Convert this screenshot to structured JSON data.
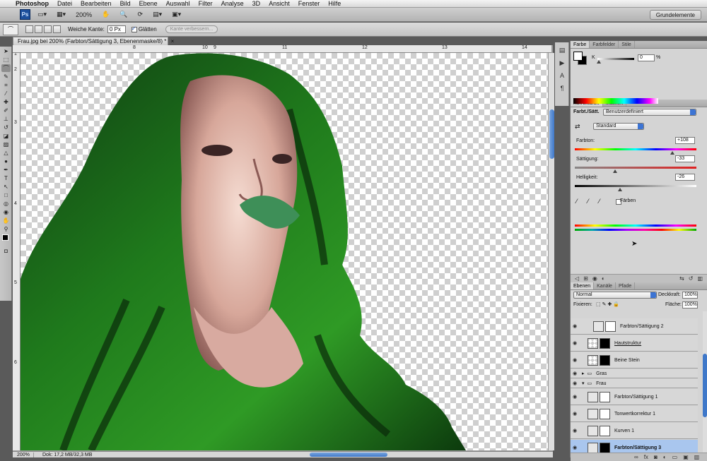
{
  "menubar": {
    "apple": "",
    "items": [
      "Photoshop",
      "Datei",
      "Bearbeiten",
      "Bild",
      "Ebene",
      "Auswahl",
      "Filter",
      "Analyse",
      "3D",
      "Ansicht",
      "Fenster",
      "Hilfe"
    ]
  },
  "appbar": {
    "ps_logo": "Ps",
    "zoom": "200%",
    "workspace": "Grundelemente"
  },
  "options": {
    "feather_label": "Weiche Kante:",
    "feather_value": "0 Px",
    "antialias_label": "Glätten",
    "refine_edge": "Kante verbessern..."
  },
  "document": {
    "tab_title": "Frau.jpg bei 200% (Farbton/Sättigung 3, Ebenenmaske/8) *",
    "ruler_h": [
      "8",
      "9",
      "10",
      "11",
      "12",
      "13",
      "14"
    ],
    "ruler_v": [
      "1",
      "2",
      "3",
      "4",
      "5",
      "6"
    ],
    "status_zoom": "200%",
    "status_info": "Dok: 17,2 MB/32,3 MB"
  },
  "color_panel": {
    "tabs": [
      "Farbe",
      "Farbfelder",
      "Stile"
    ],
    "channel": "K",
    "value": "0",
    "unit": "%"
  },
  "adjustments_panel": {
    "tabs": [
      "Korrekturen",
      "Masken"
    ],
    "type": "Farbt./Sätt.",
    "preset": "Benutzerdefiniert",
    "range": "Standard",
    "hue_label": "Farbton:",
    "hue_value": "+108",
    "hue_level": 0.8,
    "sat_label": "Sättigung:",
    "sat_value": "-33",
    "sat_level": 0.33,
    "light_label": "Helligkeit:",
    "light_value": "-26",
    "light_level": 0.37,
    "colorize_label": "Färben"
  },
  "layers_panel": {
    "tabs": [
      "Ebenen",
      "Kanäle",
      "Pfade"
    ],
    "blend_mode": "Normal",
    "opacity_label": "Deckkraft:",
    "opacity_value": "100%",
    "lock_label": "Fixieren:",
    "fill_label": "Fläche:",
    "fill_value": "100%",
    "layers": [
      {
        "name": "Farbton/Sättigung 2",
        "kind": "adj"
      },
      {
        "name": "Hautstruktur",
        "kind": "pixel"
      },
      {
        "name": "Beine Stein",
        "kind": "pixel"
      },
      {
        "name": "Gras",
        "kind": "group"
      },
      {
        "name": "Frau",
        "kind": "group"
      },
      {
        "name": "Farbton/Sättigung 1",
        "kind": "adj"
      },
      {
        "name": "Tonwertkorrektur 1",
        "kind": "adj"
      },
      {
        "name": "Kurven 1",
        "kind": "adj"
      },
      {
        "name": "Farbton/Sättigung 3",
        "kind": "adj"
      }
    ]
  }
}
